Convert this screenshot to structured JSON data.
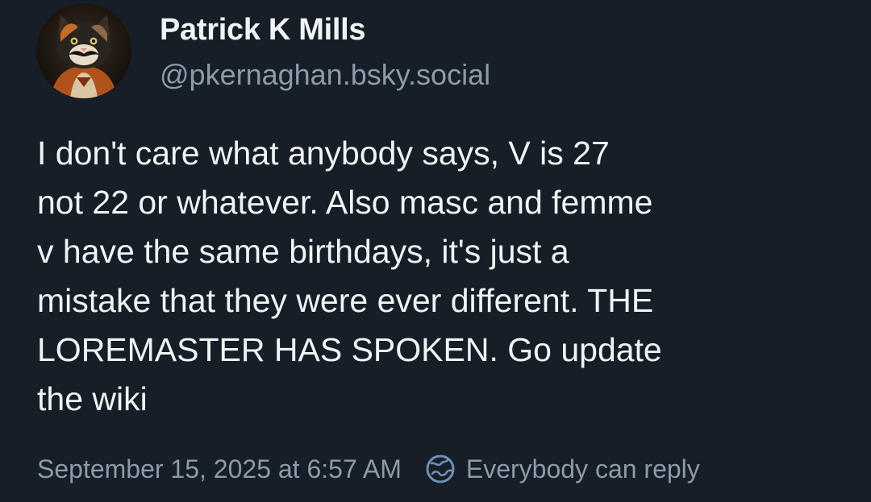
{
  "author": {
    "display_name": "Patrick K Mills",
    "handle": "@pkernaghan.bsky.social"
  },
  "post": {
    "text": "I don't care what anybody says, V is 27\nnot 22 or whatever. Also masc and femme\nv have the same birthdays, it's just a\nmistake that they were ever different. THE\nLOREMASTER HAS SPOKEN. Go update\nthe wiki",
    "timestamp": "September 15, 2025 at 6:57 AM",
    "reply_setting": "Everybody can reply",
    "reply_icon": "globe-icon"
  },
  "colors": {
    "background": "#161e27",
    "text_primary": "#f1f3f5",
    "text_secondary": "#8d9aa9",
    "icon_accent": "#6f8fb5"
  }
}
